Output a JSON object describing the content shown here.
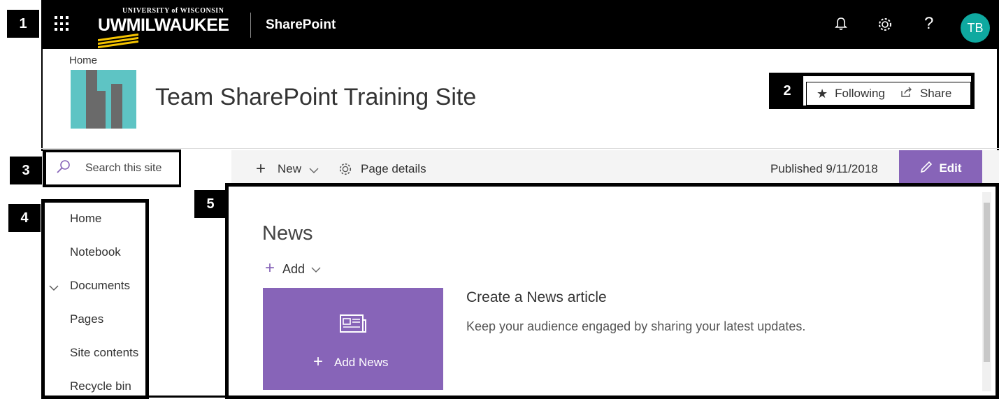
{
  "callouts": [
    "1",
    "2",
    "3",
    "4",
    "5"
  ],
  "suitebar": {
    "logo_top": "UNIVERSITY of WISCONSIN",
    "logo_main": "UWMILWAUKEE",
    "app_title": "SharePoint",
    "avatar_initials": "TB",
    "icons": [
      "waffle-icon",
      "bell-icon",
      "gear-icon",
      "help-icon"
    ]
  },
  "header": {
    "breadcrumb": "Home",
    "site_title": "Team SharePoint Training Site",
    "following_label": "Following",
    "share_label": "Share"
  },
  "commandbar": {
    "new_label": "New",
    "page_details_label": "Page details",
    "published": "Published 9/11/2018",
    "edit_label": "Edit"
  },
  "search": {
    "placeholder": "Search this site"
  },
  "nav": {
    "items": [
      {
        "label": "Home"
      },
      {
        "label": "Notebook"
      },
      {
        "label": "Documents"
      },
      {
        "label": "Pages"
      },
      {
        "label": "Site contents"
      },
      {
        "label": "Recycle bin"
      }
    ]
  },
  "content": {
    "news_title": "News",
    "add_label": "Add",
    "add_news_label": "Add News",
    "create_title": "Create a News article",
    "create_desc": "Keep your audience engaged by sharing your latest updates."
  },
  "colors": {
    "accent": "#8764b8",
    "avatar": "#0fa9a0",
    "suitebar": "#000000"
  }
}
